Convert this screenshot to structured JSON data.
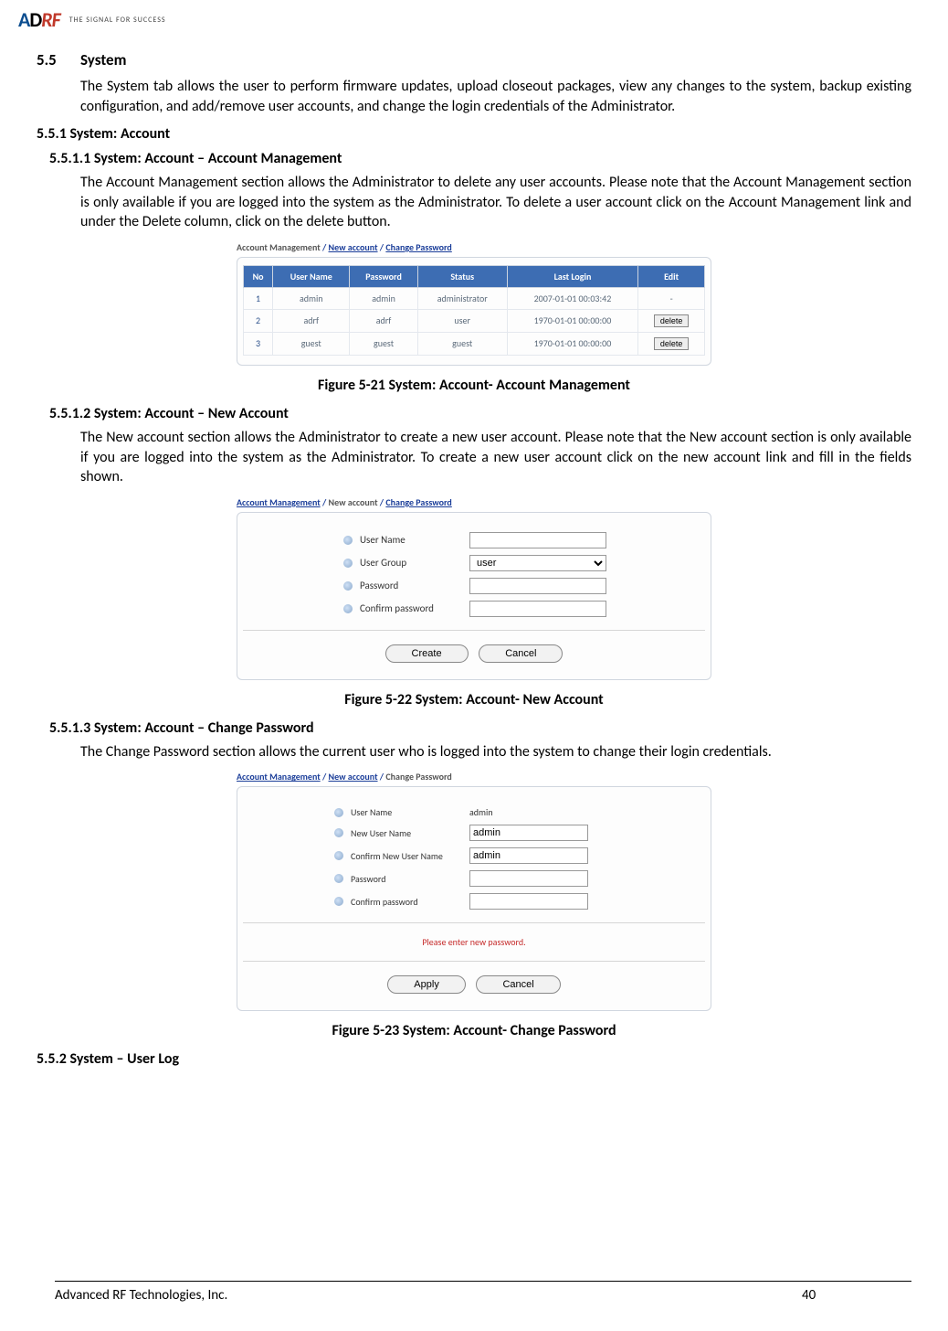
{
  "logo": {
    "brand_a": "A",
    "brand_d": "D",
    "brand_rf": "RF",
    "tagline": "THE SIGNAL FOR SUCCESS"
  },
  "s55": {
    "num": "5.5",
    "title": "System",
    "body": "The System tab allows the user to perform firmware updates, upload closeout packages, view any changes to the system, backup existing configuration, and add/remove user accounts, and change the login credentials of the Administrator."
  },
  "s551": {
    "title": "5.5.1   System: Account"
  },
  "s5511": {
    "title": "5.5.1.1   System: Account – Account Management",
    "body": "The Account Management section allows the Administrator to delete any user accounts.  Please note that the Account Management section is only available if you are logged into the system as the Administrator.  To delete a user account click on the Account Management link and under the Delete column, click on the delete button."
  },
  "shot1": {
    "crumb_mgmt": "Account Management",
    "crumb_new": "New account",
    "crumb_chpw": "Change Password",
    "headers": {
      "no": "No",
      "user": "User Name",
      "pw": "Password",
      "status": "Status",
      "last": "Last Login",
      "edit": "Edit"
    },
    "rows": [
      {
        "no": "1",
        "user": "admin",
        "pw": "admin",
        "status": "administrator",
        "last": "2007-01-01 00:03:42",
        "edit": "-"
      },
      {
        "no": "2",
        "user": "adrf",
        "pw": "adrf",
        "status": "user",
        "last": "1970-01-01 00:00:00",
        "edit": "delete"
      },
      {
        "no": "3",
        "user": "guest",
        "pw": "guest",
        "status": "guest",
        "last": "1970-01-01 00:00:00",
        "edit": "delete"
      }
    ]
  },
  "fig521": "Figure 5-21   System: Account- Account Management",
  "s5512": {
    "title": "5.5.1.2   System: Account – New Account",
    "body": "The New account section allows the Administrator to create a new user account.  Please note that the New account section is only available if you are logged into the system as the Administrator.  To create a new user account click on the new account link and fill in the fields shown."
  },
  "shot2": {
    "crumb_mgmt": "Account Management",
    "crumb_new": "New account",
    "crumb_chpw": "Change Password",
    "labels": {
      "user": "User Name",
      "group": "User Group",
      "pw": "Password",
      "cpw": "Confirm password"
    },
    "group_selected": "user",
    "btn_create": "Create",
    "btn_cancel": "Cancel"
  },
  "fig522": "Figure 5-22   System: Account- New Account",
  "s5513": {
    "title": "5.5.1.3   System: Account – Change Password",
    "body": "The Change Password section allows the current user who is logged into the system to change their login credentials."
  },
  "shot3": {
    "crumb_mgmt": "Account Management",
    "crumb_new": "New account",
    "crumb_chpw": "Change Password",
    "labels": {
      "user": "User Name",
      "newuser": "New User Name",
      "cnewuser": "Confirm New User Name",
      "pw": "Password",
      "cpw": "Confirm password"
    },
    "val_user": "admin",
    "val_newuser": "admin",
    "val_cnewuser": "admin",
    "warning": "Please enter new password.",
    "btn_apply": "Apply",
    "btn_cancel": "Cancel"
  },
  "fig523": "Figure 5-23   System: Account- Change Password",
  "s552": {
    "title": "5.5.2   System – User Log"
  },
  "footer": {
    "company": "Advanced RF Technologies, Inc.",
    "page": "40"
  }
}
